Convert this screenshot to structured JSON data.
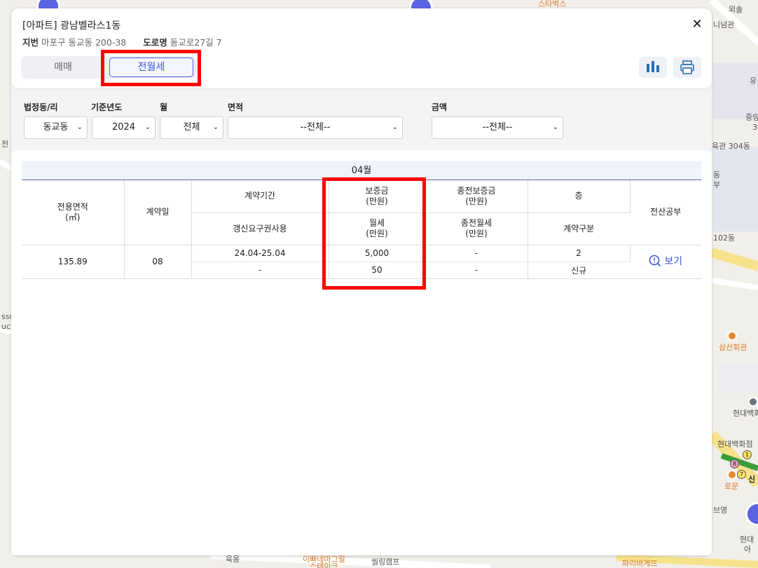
{
  "map": {
    "labels": [
      "스타벅스",
      "외솔",
      "니넘관",
      "유",
      "중앙",
      "3",
      "육관 304동",
      "동",
      "부",
      "102동",
      "sso",
      "uc",
      "삼산회관",
      "현대백화",
      "현대백화점",
      "신",
      "로운",
      "브영",
      "현대",
      "아",
      "육몽",
      "이빠네마그릴",
      "스테이크",
      "씰링캠프",
      "파리바게뜨",
      "전"
    ]
  },
  "header": {
    "title": "[아파트] 광남벨라스1동",
    "jibun_label": "지번",
    "jibun_value": "마포구 동교동 200-38",
    "road_label": "도로명",
    "road_value": "동교로27길 7",
    "close_icon": "✕"
  },
  "tabs": [
    {
      "label": "매매",
      "active": false
    },
    {
      "label": "전월세",
      "active": true
    }
  ],
  "toolbar": {
    "chart_icon": "bar-chart-icon",
    "print_icon": "printer-icon"
  },
  "filters": {
    "dong": {
      "label": "법정동/리",
      "value": "동교동"
    },
    "year": {
      "label": "기준년도",
      "value": "2024"
    },
    "month": {
      "label": "월",
      "value": "전체"
    },
    "area": {
      "label": "면적",
      "value": "--전체--"
    },
    "amount": {
      "label": "금액",
      "value": "--전체--"
    }
  },
  "results": {
    "month": "04월",
    "headers": {
      "area": "전용면적\n(㎡)",
      "date": "계약일",
      "period": "계약기간",
      "deposit": "보증금\n(만원)",
      "prev_deposit": "종전보증금\n(만원)",
      "floor": "층",
      "registry": "전산공부",
      "renewal": "갱신요구권사용",
      "monthly": "월세\n(만원)",
      "prev_monthly": "종전월세\n(만원)",
      "contract_type": "계약구분"
    },
    "rows": [
      {
        "area": "135.89",
        "date": "08",
        "period": "24.04-25.04",
        "deposit": "5,000",
        "prev_deposit": "-",
        "floor": "2",
        "renewal": "-",
        "monthly": "50",
        "prev_monthly": "-",
        "contract_type": "신규",
        "view": "보기"
      }
    ]
  },
  "colors": {
    "accent": "#3d57d8",
    "highlight": "#ff0000",
    "map_pin": "#5b63e0"
  }
}
